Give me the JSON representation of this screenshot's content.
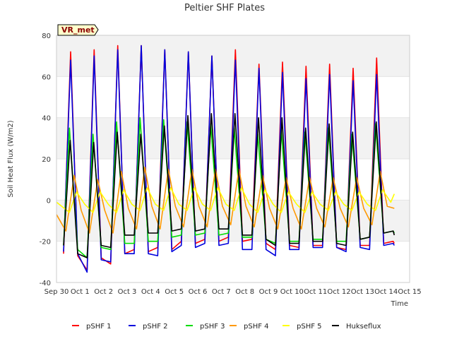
{
  "chart_data": {
    "type": "line",
    "title": "Peltier SHF Plates",
    "xlabel": "Time",
    "ylabel": "Soil Heat Flux (W/m2)",
    "badge": "VR_met",
    "xlim": [
      0,
      15
    ],
    "ylim": [
      -40,
      80
    ],
    "x_ticks": [
      {
        "pos": 0,
        "label": "Sep 30"
      },
      {
        "pos": 1,
        "label": "Oct 1"
      },
      {
        "pos": 2,
        "label": "Oct 2"
      },
      {
        "pos": 3,
        "label": "Oct 3"
      },
      {
        "pos": 4,
        "label": "Oct 4"
      },
      {
        "pos": 5,
        "label": "Oct 5"
      },
      {
        "pos": 6,
        "label": "Oct 6"
      },
      {
        "pos": 7,
        "label": "Oct 7"
      },
      {
        "pos": 8,
        "label": "Oct 8"
      },
      {
        "pos": 9,
        "label": "Oct 9"
      },
      {
        "pos": 10,
        "label": "Oct 10"
      },
      {
        "pos": 11,
        "label": "Oct 11"
      },
      {
        "pos": 12,
        "label": "Oct 12"
      },
      {
        "pos": 13,
        "label": "Oct 13"
      },
      {
        "pos": 14,
        "label": "Oct 14"
      },
      {
        "pos": 15,
        "label": "Oct 15"
      }
    ],
    "y_ticks": [
      -40,
      -20,
      0,
      20,
      40,
      60,
      80
    ],
    "grid_bands": true,
    "legend_position": "bottom",
    "series": [
      {
        "name": "pSHF 1",
        "color": "#ff0000",
        "x": [
          0.3,
          0.6,
          0.9,
          1.3,
          1.6,
          1.9,
          2.3,
          2.6,
          2.9,
          3.3,
          3.6,
          3.9,
          4.3,
          4.6,
          4.9,
          5.3,
          5.6,
          5.9,
          6.3,
          6.6,
          6.9,
          7.3,
          7.6,
          7.9,
          8.3,
          8.6,
          8.9,
          9.3,
          9.6,
          9.9,
          10.3,
          10.6,
          10.9,
          11.3,
          11.6,
          11.9,
          12.3,
          12.6,
          12.9,
          13.3,
          13.6,
          13.9,
          14.3,
          14.35
        ],
        "y": [
          -26,
          72,
          -27,
          -34,
          73,
          -28,
          -31,
          75,
          -26,
          -24,
          75,
          -25,
          -23,
          73,
          -24,
          -20,
          72,
          -21,
          -19,
          70,
          -20,
          -18,
          73,
          -20,
          -19,
          66,
          -21,
          -24,
          67,
          -22,
          -23,
          65,
          -22,
          -22,
          66,
          -23,
          -24,
          64,
          -22,
          -22,
          69,
          -21,
          -20,
          -21
        ]
      },
      {
        "name": "pSHF 2",
        "color": "#0000dd",
        "x": [
          0.3,
          0.6,
          0.9,
          1.3,
          1.6,
          1.9,
          2.3,
          2.6,
          2.9,
          3.3,
          3.6,
          3.9,
          4.3,
          4.6,
          4.9,
          5.3,
          5.6,
          5.9,
          6.3,
          6.6,
          6.9,
          7.3,
          7.6,
          7.9,
          8.3,
          8.6,
          8.9,
          9.3,
          9.6,
          9.9,
          10.3,
          10.6,
          10.9,
          11.3,
          11.6,
          11.9,
          12.3,
          12.6,
          12.9,
          13.3,
          13.6,
          13.9,
          14.3,
          14.35
        ],
        "y": [
          -25,
          68,
          -26,
          -35,
          70,
          -29,
          -30,
          73,
          -26,
          -26,
          75,
          -26,
          -27,
          73,
          -25,
          -22,
          72,
          -23,
          -21,
          70,
          -22,
          -21,
          68,
          -24,
          -24,
          64,
          -24,
          -27,
          62,
          -24,
          -24,
          59,
          -23,
          -23,
          61,
          -23,
          -25,
          58,
          -23,
          -24,
          61,
          -22,
          -21,
          -22
        ]
      },
      {
        "name": "pSHF 3",
        "color": "#00dd00",
        "x": [
          0.3,
          0.55,
          0.9,
          1.3,
          1.55,
          1.9,
          2.3,
          2.55,
          2.9,
          3.3,
          3.55,
          3.9,
          4.3,
          4.55,
          4.9,
          5.3,
          5.55,
          5.9,
          6.3,
          6.55,
          6.9,
          7.3,
          7.55,
          7.9,
          8.3,
          8.55,
          8.9,
          9.3,
          9.55,
          9.9,
          10.3,
          10.55,
          10.9,
          11.3,
          11.55,
          11.9,
          12.3,
          12.55,
          12.9,
          13.3,
          13.55,
          13.9,
          14.3,
          14.35
        ],
        "y": [
          -22,
          35,
          -24,
          -28,
          32,
          -23,
          -24,
          38,
          -21,
          -21,
          40,
          -20,
          -20,
          39,
          -18,
          -17,
          38,
          -17,
          -16,
          37,
          -17,
          -16,
          35,
          -18,
          -18,
          32,
          -19,
          -21,
          34,
          -20,
          -20,
          33,
          -19,
          -19,
          35,
          -20,
          -20,
          32,
          -19,
          -18,
          37,
          -16,
          -15,
          -16
        ]
      },
      {
        "name": "pSHF 4",
        "color": "#ff9900",
        "x": [
          0.0,
          0.4,
          0.75,
          1.05,
          1.4,
          1.75,
          2.05,
          2.4,
          2.75,
          3.05,
          3.4,
          3.75,
          4.05,
          4.4,
          4.75,
          5.05,
          5.4,
          5.75,
          6.05,
          6.4,
          6.75,
          7.05,
          7.4,
          7.75,
          8.05,
          8.4,
          8.75,
          9.05,
          9.4,
          9.75,
          10.05,
          10.4,
          10.75,
          11.05,
          11.4,
          11.75,
          12.05,
          12.4,
          12.75,
          13.05,
          13.4,
          13.75,
          14.05,
          14.35
        ],
        "y": [
          -7,
          -15,
          12,
          -5,
          -16,
          10,
          -5,
          -16,
          14,
          -4,
          -14,
          16,
          -3,
          -14,
          15,
          -3,
          -13,
          15,
          -3,
          -13,
          15,
          -3,
          -12,
          15,
          -3,
          -13,
          12,
          -4,
          -14,
          11,
          -4,
          -14,
          11,
          -4,
          -13,
          11,
          -4,
          -13,
          11,
          -4,
          -12,
          14,
          -3,
          -4
        ]
      },
      {
        "name": "pSHF 5",
        "color": "#ffff00",
        "x": [
          0.0,
          0.55,
          0.85,
          1.2,
          1.55,
          1.85,
          2.2,
          2.55,
          2.85,
          3.2,
          3.55,
          3.85,
          4.2,
          4.55,
          4.85,
          5.2,
          5.55,
          5.85,
          6.2,
          6.55,
          6.85,
          7.2,
          7.55,
          7.85,
          8.2,
          8.55,
          8.85,
          9.2,
          9.55,
          9.85,
          10.2,
          10.55,
          10.85,
          11.2,
          11.55,
          11.85,
          12.2,
          12.55,
          12.85,
          13.2,
          13.55,
          13.85,
          14.2,
          14.35
        ],
        "y": [
          -1,
          -6,
          4,
          -2,
          -6,
          4,
          -2,
          -6,
          5,
          -2,
          -5,
          6,
          -2,
          -5,
          6,
          -2,
          -5,
          6,
          -2,
          -5,
          6,
          -2,
          -5,
          6,
          -2,
          -6,
          5,
          -2,
          -6,
          4,
          -2,
          -6,
          4,
          -2,
          -5,
          4,
          -2,
          -5,
          4,
          -2,
          -5,
          5,
          -1,
          3
        ]
      },
      {
        "name": "Hukseflux",
        "color": "#000000",
        "x": [
          0.3,
          0.58,
          0.9,
          1.3,
          1.58,
          1.9,
          2.3,
          2.58,
          2.9,
          3.3,
          3.58,
          3.9,
          4.3,
          4.58,
          4.9,
          5.3,
          5.58,
          5.9,
          6.3,
          6.58,
          6.9,
          7.3,
          7.58,
          7.9,
          8.3,
          8.58,
          8.9,
          9.3,
          9.58,
          9.9,
          10.3,
          10.58,
          10.9,
          11.3,
          11.58,
          11.9,
          12.3,
          12.58,
          12.9,
          13.3,
          13.58,
          13.9,
          14.3,
          14.35
        ],
        "y": [
          -22,
          29,
          -26,
          -28,
          28,
          -22,
          -23,
          33,
          -17,
          -17,
          32,
          -16,
          -16,
          36,
          -15,
          -14,
          41,
          -15,
          -14,
          42,
          -14,
          -14,
          42,
          -17,
          -17,
          40,
          -19,
          -22,
          40,
          -21,
          -21,
          35,
          -20,
          -20,
          37,
          -21,
          -22,
          33,
          -19,
          -18,
          38,
          -16,
          -15,
          -17
        ]
      }
    ]
  }
}
